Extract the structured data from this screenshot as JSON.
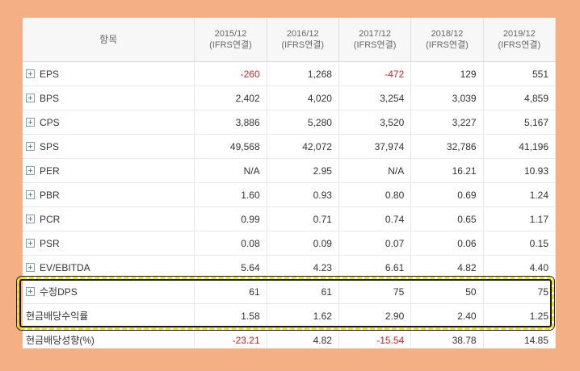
{
  "table": {
    "header_label": "항목",
    "columns": [
      {
        "period": "2015/12",
        "basis": "(IFRS연결)"
      },
      {
        "period": "2016/12",
        "basis": "(IFRS연결)"
      },
      {
        "period": "2017/12",
        "basis": "(IFRS연결)"
      },
      {
        "period": "2018/12",
        "basis": "(IFRS연결)"
      },
      {
        "period": "2019/12",
        "basis": "(IFRS연결)"
      }
    ],
    "rows": [
      {
        "label": "EPS",
        "expandable": true,
        "values": [
          "-260",
          "1,268",
          "-472",
          "129",
          "551"
        ]
      },
      {
        "label": "BPS",
        "expandable": true,
        "values": [
          "2,402",
          "4,020",
          "3,254",
          "3,039",
          "4,859"
        ]
      },
      {
        "label": "CPS",
        "expandable": true,
        "values": [
          "3,886",
          "5,280",
          "3,520",
          "3,227",
          "5,167"
        ]
      },
      {
        "label": "SPS",
        "expandable": true,
        "values": [
          "49,568",
          "42,072",
          "37,974",
          "32,786",
          "41,196"
        ]
      },
      {
        "label": "PER",
        "expandable": true,
        "values": [
          "N/A",
          "2.95",
          "N/A",
          "16.21",
          "10.93"
        ]
      },
      {
        "label": "PBR",
        "expandable": true,
        "values": [
          "1.60",
          "0.93",
          "0.80",
          "0.69",
          "1.24"
        ]
      },
      {
        "label": "PCR",
        "expandable": true,
        "values": [
          "0.99",
          "0.71",
          "0.74",
          "0.65",
          "1.17"
        ]
      },
      {
        "label": "PSR",
        "expandable": true,
        "values": [
          "0.08",
          "0.09",
          "0.07",
          "0.06",
          "0.15"
        ]
      },
      {
        "label": "EV/EBITDA",
        "expandable": true,
        "values": [
          "5.64",
          "4.23",
          "6.61",
          "4.82",
          "4.40"
        ]
      },
      {
        "label": "수정DPS",
        "expandable": true,
        "values": [
          "61",
          "61",
          "75",
          "50",
          "75"
        ]
      },
      {
        "label": "현금배당수익률",
        "expandable": false,
        "values": [
          "1.58",
          "1.62",
          "2.90",
          "2.40",
          "1.25"
        ]
      },
      {
        "label": "현금배당성향(%)",
        "expandable": false,
        "values": [
          "-23.21",
          "4.82",
          "-15.54",
          "38.78",
          "14.85"
        ]
      }
    ],
    "expand_icon": "plus-box-icon"
  },
  "colors": {
    "background": "#f4b084",
    "negative": "#e02020",
    "highlight_border": "#f2e600"
  }
}
